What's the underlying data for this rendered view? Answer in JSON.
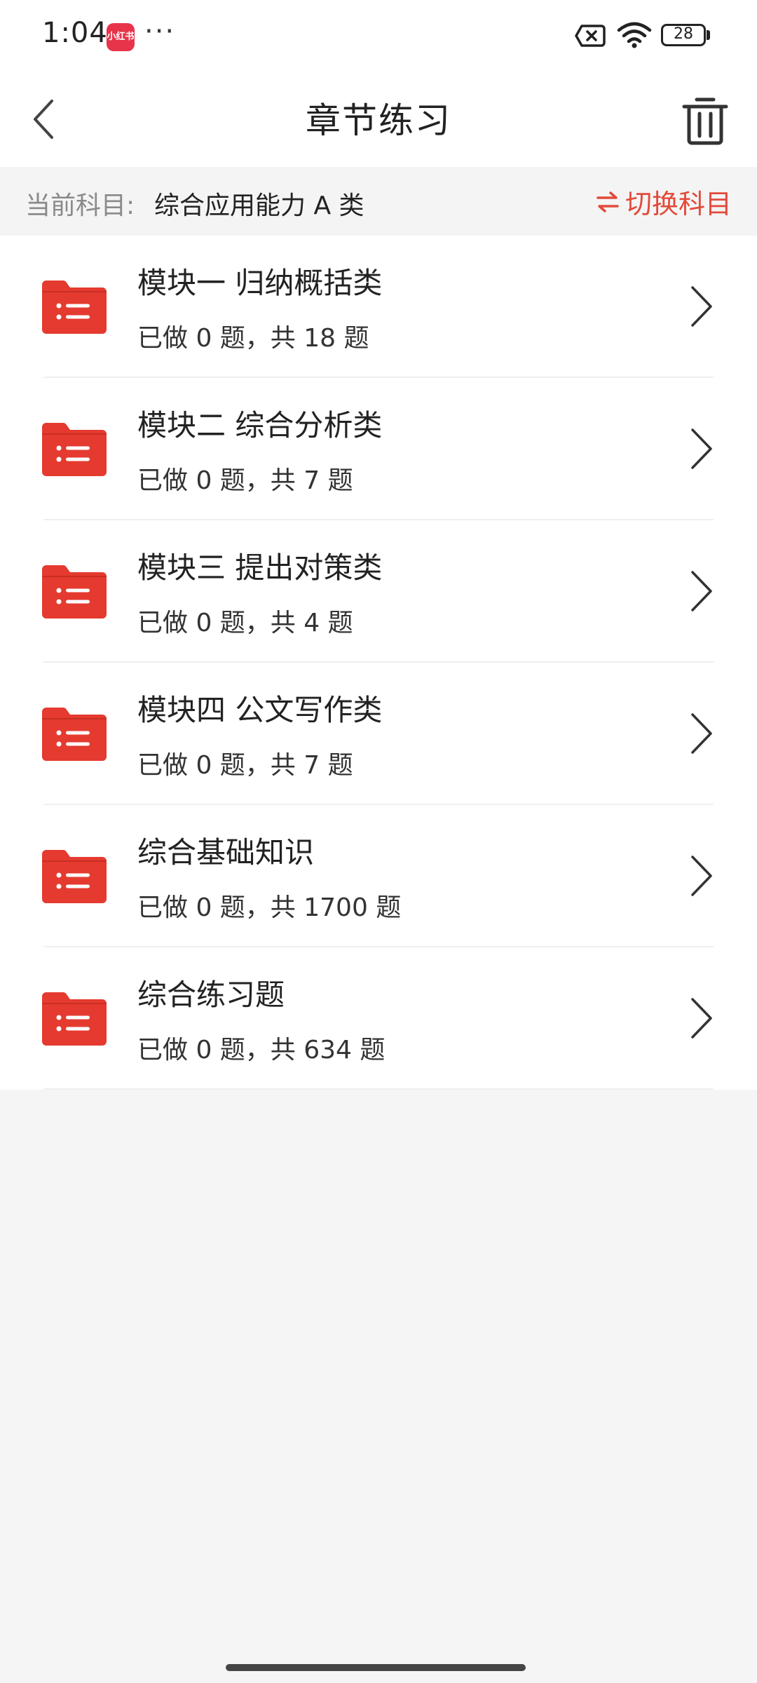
{
  "status": {
    "time": "1:04",
    "app_badge": "小红书",
    "dots": "···",
    "battery": "28"
  },
  "nav": {
    "title": "章节练习"
  },
  "subject": {
    "label": "当前科目:",
    "value": "综合应用能力 A 类",
    "switch_label": "切换科目"
  },
  "colors": {
    "accent": "#e24a3b",
    "folder": "#e53a2f"
  },
  "items": [
    {
      "title": "模块一 归纳概括类",
      "progress": "已做 0 题，共 18 题"
    },
    {
      "title": "模块二 综合分析类",
      "progress": "已做 0 题，共 7 题"
    },
    {
      "title": "模块三 提出对策类",
      "progress": "已做 0 题，共 4 题"
    },
    {
      "title": "模块四 公文写作类",
      "progress": "已做 0 题，共 7 题"
    },
    {
      "title": "综合基础知识",
      "progress": "已做 0 题，共 1700 题"
    },
    {
      "title": "综合练习题",
      "progress": "已做 0 题，共 634 题"
    }
  ]
}
